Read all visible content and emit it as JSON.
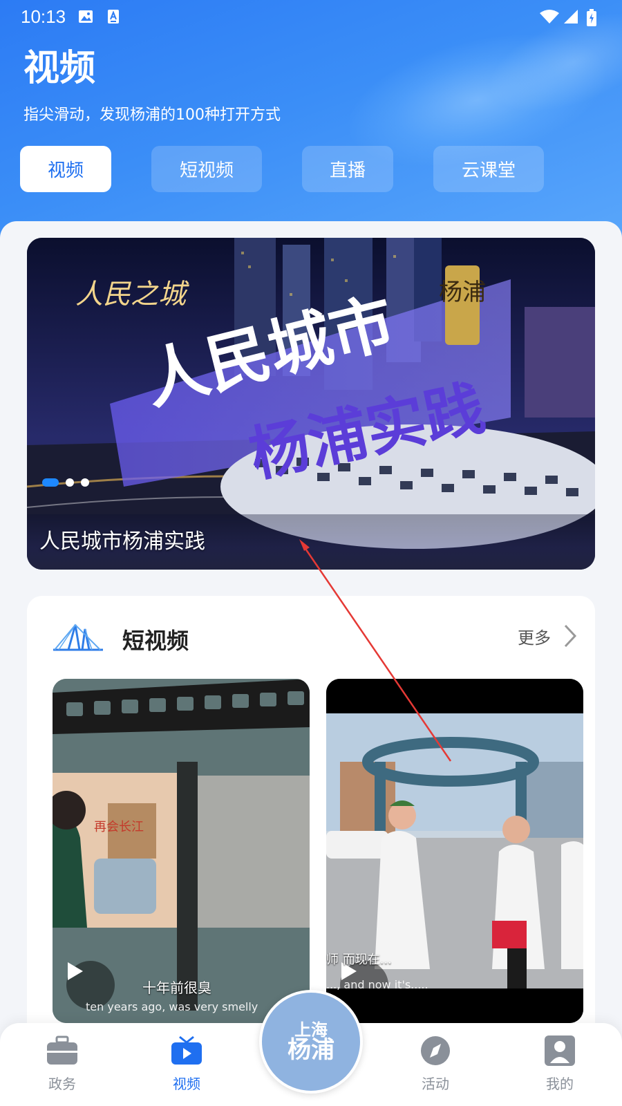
{
  "status_bar": {
    "time": "10:13"
  },
  "header": {
    "title": "视频",
    "subtitle": "指尖滑动，发现杨浦的100种打开方式"
  },
  "tabs": [
    {
      "label": "视频",
      "active": true
    },
    {
      "label": "短视频",
      "active": false
    },
    {
      "label": "直播",
      "active": false
    },
    {
      "label": "云课堂",
      "active": false
    }
  ],
  "banner": {
    "caption": "人民城市杨浦实践",
    "image_text": {
      "corner_logo": "人民之城",
      "headline_top": "人民城市",
      "headline_bottom": "杨浦实践",
      "seal": "杨浦"
    },
    "pagination": {
      "count": 3,
      "active_index": 0
    }
  },
  "short_video_section": {
    "title": "短视频",
    "more_label": "更多",
    "items": [
      {
        "caption": "十年前很臭",
        "subtitle": "ten years ago, was very smelly",
        "poster_text": "再会长江"
      },
      {
        "caption": "师 而现在...",
        "subtitle": "..., and now it's....."
      }
    ]
  },
  "bottom_nav": {
    "items": [
      {
        "label": "政务",
        "icon": "briefcase-icon",
        "active": false
      },
      {
        "label": "视频",
        "icon": "tv-icon",
        "active": true
      },
      {
        "label": "活动",
        "icon": "compass-icon",
        "active": false
      },
      {
        "label": "我的",
        "icon": "user-icon",
        "active": false
      }
    ],
    "center_logo": {
      "line1": "上海",
      "line2": "杨浦"
    }
  },
  "colors": {
    "header_blue": "#2c7bf4",
    "active_blue": "#1f6ff0",
    "inactive_gray": "#8a9099",
    "annotation_red": "#e53935"
  }
}
